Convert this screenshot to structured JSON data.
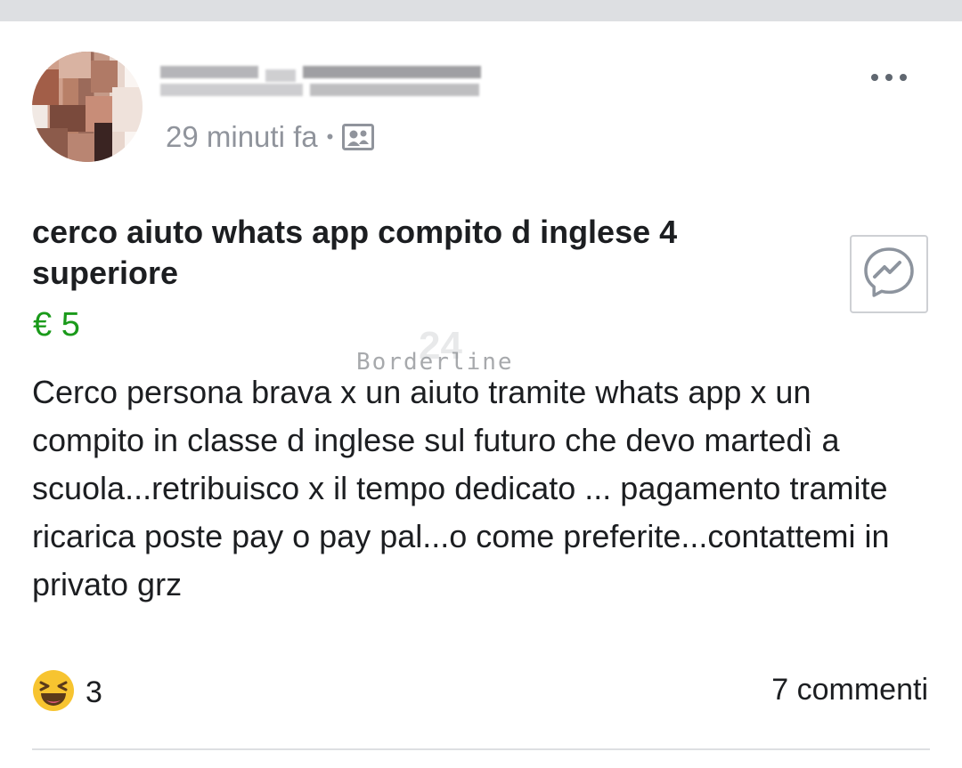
{
  "post": {
    "timestamp": "29 minuti fa",
    "title": "cerco aiuto whats app compito d inglese 4 superiore",
    "price": "€ 5",
    "watermark": "Borderline",
    "watermark_number": "24",
    "body": "Cerco persona brava x un aiuto tramite whats app x un compito in classe d inglese sul futuro che devo martedì a scuola...retribuisco x il tempo dedicato ... pagamento tramite ricarica poste pay o pay pal...o come preferite...contattemi in privato grz",
    "reactions": {
      "icon": "laughing-emoji-icon",
      "count": "3"
    },
    "comments_label": "7 commenti"
  },
  "icons": {
    "more": "more-options-icon",
    "audience": "group-audience-icon",
    "messenger": "messenger-icon"
  },
  "colors": {
    "price": "#1a9a1a",
    "meta": "#90949c",
    "background_bar": "#dddfe2"
  }
}
